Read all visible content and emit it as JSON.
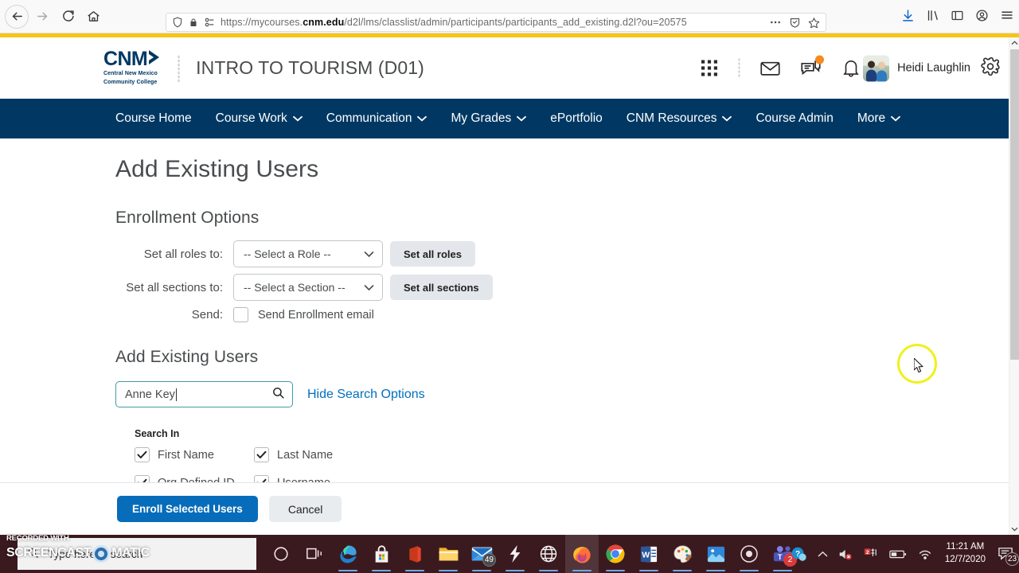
{
  "browser": {
    "url_prefix": "https://mycourses.",
    "url_bold": "cnm.edu",
    "url_suffix": "/d2l/lms/classlist/admin/participants/participants_add_existing.d2l?ou=20575",
    "back_icon": "back-arrow-icon",
    "forward_icon": "forward-arrow-icon",
    "reload_icon": "reload-icon",
    "home_icon": "home-icon",
    "shield_icon": "shield-icon",
    "lock_icon": "lock-icon",
    "permissions_icon": "permissions-icon",
    "page_actions_icon": "ellipsis-icon",
    "reader_icon": "reader-mode-icon",
    "bookmark_icon": "star-icon",
    "downloads_icon": "download-icon",
    "library_icon": "library-icon",
    "sidebar_icon": "sidebar-icon",
    "account_icon": "account-icon",
    "menu_icon": "hamburger-menu-icon"
  },
  "header": {
    "logo_text": "CNM",
    "logo_tagline_line1": "Central New Mexico",
    "logo_tagline_line2": "Community College",
    "course_title": "INTRO TO TOURISM (D01)",
    "user_name": "Heidi Laughlin",
    "icons": {
      "waffle": "app-grid-icon",
      "email": "envelope-icon",
      "messages": "chat-bubble-icon",
      "alerts": "bell-icon",
      "settings": "gear-icon"
    }
  },
  "nav": {
    "items": [
      {
        "label": "Course Home",
        "caret": false
      },
      {
        "label": "Course Work",
        "caret": true
      },
      {
        "label": "Communication",
        "caret": true
      },
      {
        "label": "My Grades",
        "caret": true
      },
      {
        "label": "ePortfolio",
        "caret": false
      },
      {
        "label": "CNM Resources",
        "caret": true
      },
      {
        "label": "Course Admin",
        "caret": false
      },
      {
        "label": "More",
        "caret": true
      }
    ]
  },
  "main": {
    "page_title": "Add Existing Users",
    "enrollment_heading": "Enrollment Options",
    "roles_label": "Set all roles to:",
    "roles_select_value": "-- Select a Role --",
    "roles_button": "Set all roles",
    "sections_label": "Set all sections to:",
    "sections_select_value": "-- Select a Section --",
    "sections_button": "Set all sections",
    "send_label": "Send:",
    "send_checkbox_label": "Send Enrollment email",
    "send_checked": false,
    "add_users_heading": "Add Existing Users",
    "search_value": "Anne Key",
    "search_icon": "magnifier-icon",
    "hide_search_options": "Hide Search Options",
    "search_in_label": "Search In",
    "search_in_options": [
      {
        "label": "First Name",
        "checked": true
      },
      {
        "label": "Last Name",
        "checked": true
      },
      {
        "label": "Org Defined ID",
        "checked": true
      },
      {
        "label": "Username",
        "checked": true
      }
    ]
  },
  "footer": {
    "enroll_button": "Enroll Selected Users",
    "cancel_button": "Cancel"
  },
  "taskbar": {
    "search_placeholder": "Type here to search",
    "cortana_icon": "cortana-circle-icon",
    "taskview_icon": "task-view-icon",
    "apps": [
      {
        "name": "microsoft-edge",
        "badge": ""
      },
      {
        "name": "microsoft-store",
        "badge": ""
      },
      {
        "name": "microsoft-office",
        "badge": ""
      },
      {
        "name": "file-explorer",
        "badge": ""
      },
      {
        "name": "mail",
        "badge": "49"
      },
      {
        "name": "snagit",
        "badge": ""
      },
      {
        "name": "internet-explorer",
        "badge": ""
      },
      {
        "name": "firefox",
        "badge": ""
      },
      {
        "name": "google-chrome",
        "badge": ""
      },
      {
        "name": "microsoft-word",
        "badge": ""
      },
      {
        "name": "paint",
        "badge": ""
      },
      {
        "name": "photos",
        "badge": ""
      },
      {
        "name": "screencast-o-matic",
        "badge": ""
      },
      {
        "name": "microsoft-teams",
        "badge": "2"
      }
    ],
    "tray": {
      "help_icon": "help-circle-icon",
      "overflow_icon": "chevron-up-icon",
      "volume_icon": "speaker-muted-icon",
      "updates_icon": "updates-icon",
      "battery_icon": "battery-icon",
      "network_icon": "wifi-icon",
      "time": "11:21 AM",
      "date": "12/7/2020",
      "notifications_icon": "action-center-icon",
      "notifications_badge": "23"
    }
  },
  "watermark": {
    "line1": "RECORDED WITH",
    "line2a": "SCREENCAST",
    "line2b": "MATIC"
  }
}
